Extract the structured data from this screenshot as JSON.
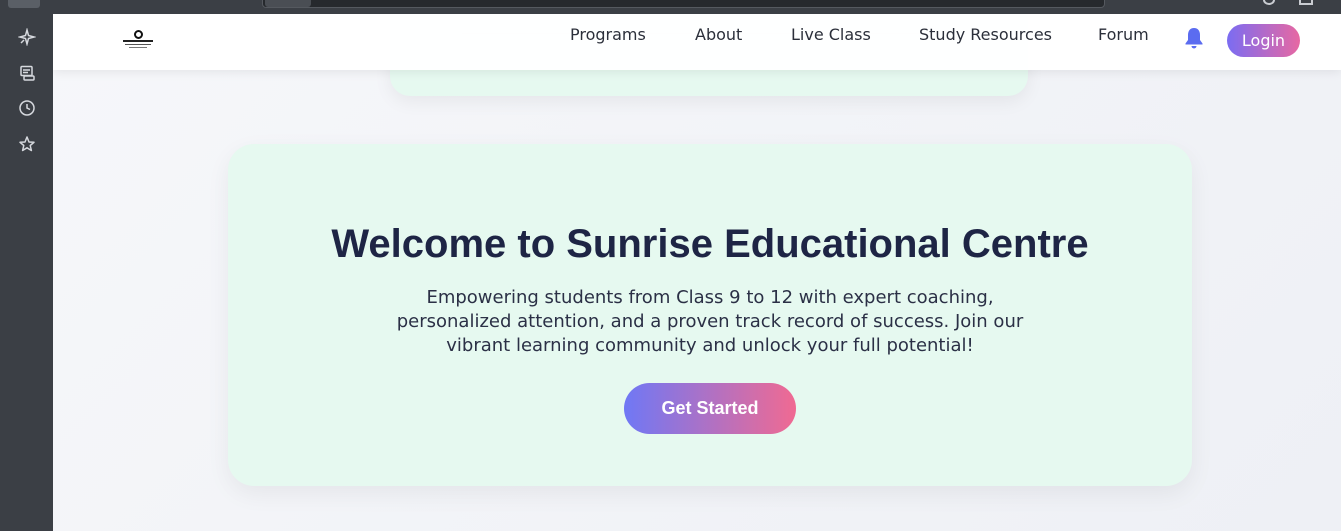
{
  "nav": {
    "links": [
      "Programs",
      "About",
      "Live Class",
      "Study Resources",
      "Forum"
    ],
    "login_label": "Login"
  },
  "hero": {
    "title": "Welcome to Sunrise Educational Centre",
    "description": "Empowering students from Class 9 to 12 with expert coaching, personalized attention, and a proven track record of success. Join our vibrant learning community and unlock your full potential!",
    "cta_label": "Get Started"
  },
  "sidebar": {
    "icons": [
      "sparkle-icon",
      "save-icon",
      "history-icon",
      "star-icon"
    ]
  },
  "colors": {
    "hero_bg": "#e6f9f0",
    "title": "#1e2545",
    "accent_from": "#6f78f5",
    "accent_to": "#f06a92",
    "bell": "#5b6cf0"
  }
}
